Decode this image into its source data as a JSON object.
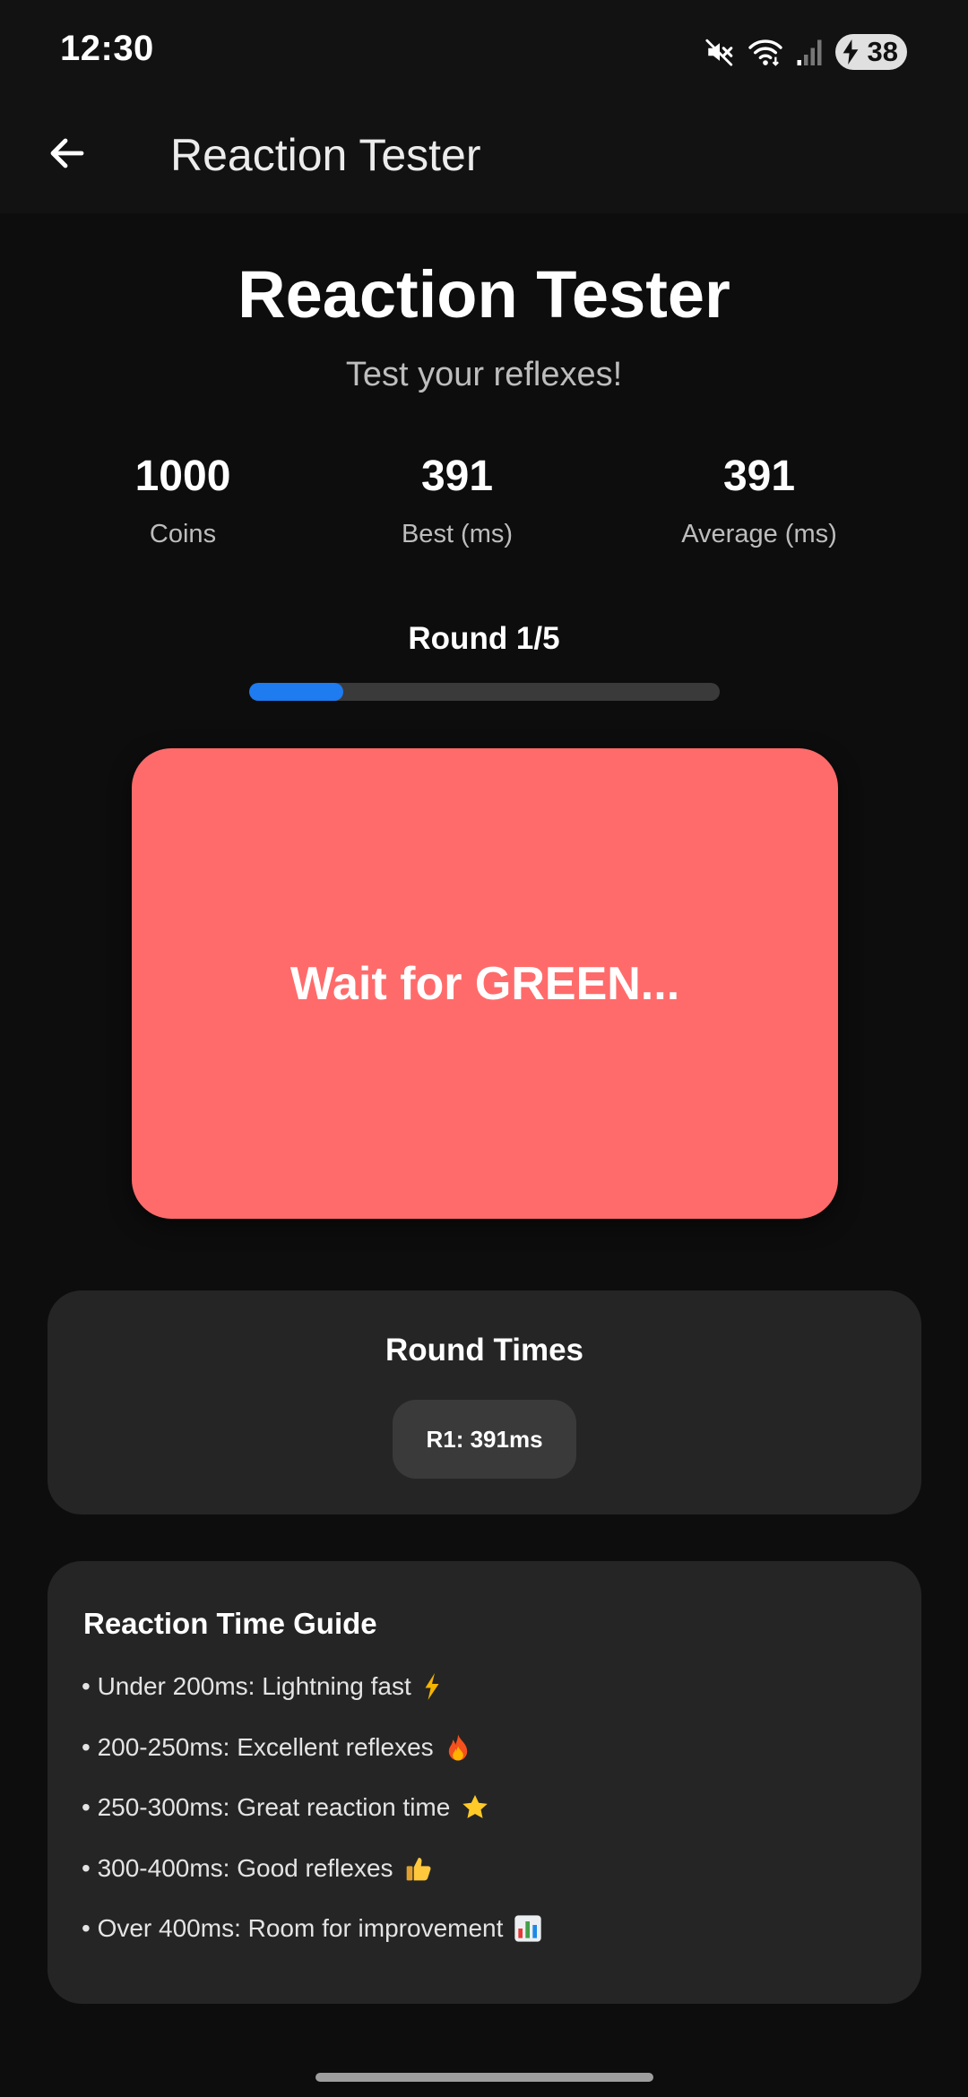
{
  "status_bar": {
    "time": "12:30",
    "battery_level": "38",
    "icons": [
      "mute-icon",
      "wifi-icon",
      "signal-icon",
      "battery-charging-icon"
    ]
  },
  "app_bar": {
    "title": "Reaction Tester",
    "back_icon": "back-arrow-icon"
  },
  "header": {
    "title": "Reaction Tester",
    "subtitle": "Test your reflexes!"
  },
  "stats": [
    {
      "value": "1000",
      "label": "Coins"
    },
    {
      "value": "391",
      "label": "Best (ms)"
    },
    {
      "value": "391",
      "label": "Average (ms)"
    }
  ],
  "round": {
    "label": "Round 1/5",
    "progress_fraction": 0.2
  },
  "reaction_pad": {
    "text": "Wait for GREEN...",
    "color": "#ff6b6b"
  },
  "round_times": {
    "title": "Round Times",
    "entries": [
      "R1: 391ms"
    ]
  },
  "guide": {
    "title": "Reaction Time Guide",
    "items": [
      {
        "text": "• Under 200ms: Lightning fast",
        "icon": "lightning-icon"
      },
      {
        "text": "• 200-250ms: Excellent reflexes",
        "icon": "fire-icon"
      },
      {
        "text": "• 250-300ms: Great reaction time",
        "icon": "star-icon"
      },
      {
        "text": "• 300-400ms: Good reflexes",
        "icon": "thumbs-up-icon"
      },
      {
        "text": "• Over 400ms: Room for improvement",
        "icon": "bar-chart-icon"
      }
    ]
  },
  "colors": {
    "background": "#0d0d0d",
    "card": "#252525",
    "accent": "#1e7bf0",
    "pad_red": "#ff6b6b"
  }
}
